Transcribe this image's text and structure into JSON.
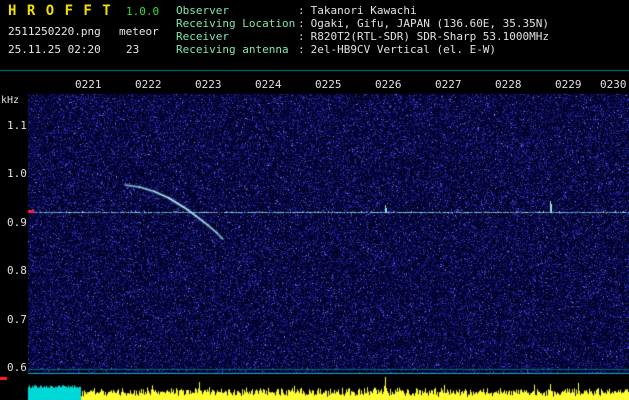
{
  "header": {
    "app_name": "H R O F F T",
    "version": "1.0.0",
    "file_name": "2511250220.png",
    "mode": "meteor",
    "datetime": "25.11.25 02:20",
    "count": "23",
    "separator": ":",
    "info_rows": [
      {
        "label": "Observer",
        "value": "Takanori Kawachi"
      },
      {
        "label": "Receiving Location",
        "value": "Ogaki, Gifu, JAPAN (136.60E, 35.35N)"
      },
      {
        "label": "Receiver",
        "value": "R820T2(RTL-SDR) SDR-Sharp 53.1000MHz"
      },
      {
        "label": "Receiving antenna",
        "value": "2el-HB9CV Vertical (el. E-W)"
      }
    ]
  },
  "chart_data": {
    "type": "heatmap",
    "title": "HROFFT radio meteor echo spectrogram",
    "x_ticks": [
      "0221",
      "0222",
      "0223",
      "0224",
      "0225",
      "0226",
      "0227",
      "0228",
      "0229",
      "0230"
    ],
    "x_axis_note": "time HHMM, 1 minute per division",
    "y_unit": "kHz",
    "y_ticks": [
      1.1,
      1.0,
      0.9,
      0.8,
      0.7,
      0.6
    ],
    "y_range_khz": [
      0.58,
      1.16
    ],
    "carrier_line_khz": 0.92,
    "carrier_blips": [
      {
        "time_min": 5.95,
        "peak_khz": 0.935
      },
      {
        "time_min": 8.7,
        "peak_khz": 0.942
      }
    ],
    "meteor_echo": {
      "shape": "descending doppler head-echo curve",
      "points": [
        {
          "time_min": 1.62,
          "khz": 0.976
        },
        {
          "time_min": 1.85,
          "khz": 0.972
        },
        {
          "time_min": 2.1,
          "khz": 0.963
        },
        {
          "time_min": 2.35,
          "khz": 0.949
        },
        {
          "time_min": 2.6,
          "khz": 0.93
        },
        {
          "time_min": 2.8,
          "khz": 0.912
        },
        {
          "time_min": 3.0,
          "khz": 0.893
        },
        {
          "time_min": 3.15,
          "khz": 0.877
        },
        {
          "time_min": 3.25,
          "khz": 0.864
        }
      ]
    },
    "noise_floor_plot": {
      "color": "#ffff33",
      "baseline_level": 0.25,
      "spikes": [
        {
          "time_min": 2.85,
          "level": 0.7
        },
        {
          "time_min": 5.95,
          "level": 1.0
        },
        {
          "time_min": 8.7,
          "level": 0.6
        }
      ],
      "saturated_block": {
        "time_min_start": 0.0,
        "time_min_end": 0.87,
        "color": "#00d8d8"
      }
    }
  },
  "colors": {
    "background": "#000000",
    "noise_dark": "#000028",
    "noise_bright": "#5050ff",
    "carrier": "#96e6e1",
    "echo": "#c0f5f0",
    "amplitude_yellow": "#ffff33",
    "saturation_block": "#00d8d8",
    "marker_red": "#ff2222",
    "separator_line": "#008080",
    "header_label_green": "#7fe8b0",
    "header_value": "#dfe4df",
    "title_yellow": "#f0e000",
    "version_green": "#33dd33",
    "tick_text": "#e0e0e0"
  }
}
